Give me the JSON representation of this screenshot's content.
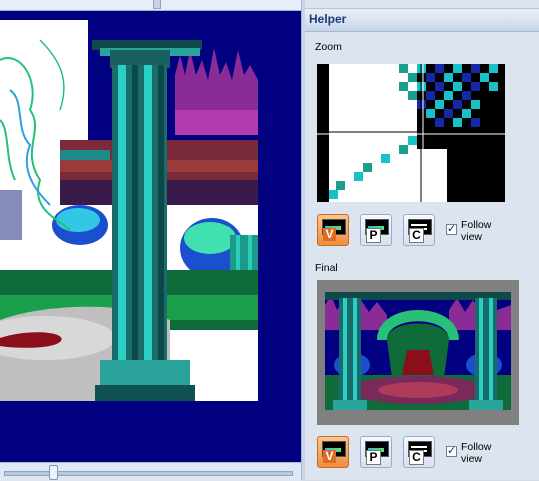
{
  "helper": {
    "title": "Helper",
    "zoom": {
      "label": "Zoom",
      "buttons": [
        {
          "letter": "V",
          "icon": "view-mode-v-icon",
          "active": true
        },
        {
          "letter": "P",
          "icon": "view-mode-p-icon",
          "active": false
        },
        {
          "letter": "C",
          "icon": "view-mode-c-icon",
          "active": false
        }
      ],
      "follow_view_label": "Follow view",
      "follow_view_checked": true
    },
    "final": {
      "label": "Final",
      "buttons": [
        {
          "letter": "V",
          "icon": "view-mode-v-icon",
          "active": true
        },
        {
          "letter": "P",
          "icon": "view-mode-p-icon",
          "active": false
        },
        {
          "letter": "C",
          "icon": "view-mode-c-icon",
          "active": false
        }
      ],
      "follow_view_label": "Follow view",
      "follow_view_checked": true
    }
  },
  "colors": {
    "canvas_bg": "#000080",
    "active_button": "#ee8d3c",
    "header_text": "#1b3c78"
  }
}
